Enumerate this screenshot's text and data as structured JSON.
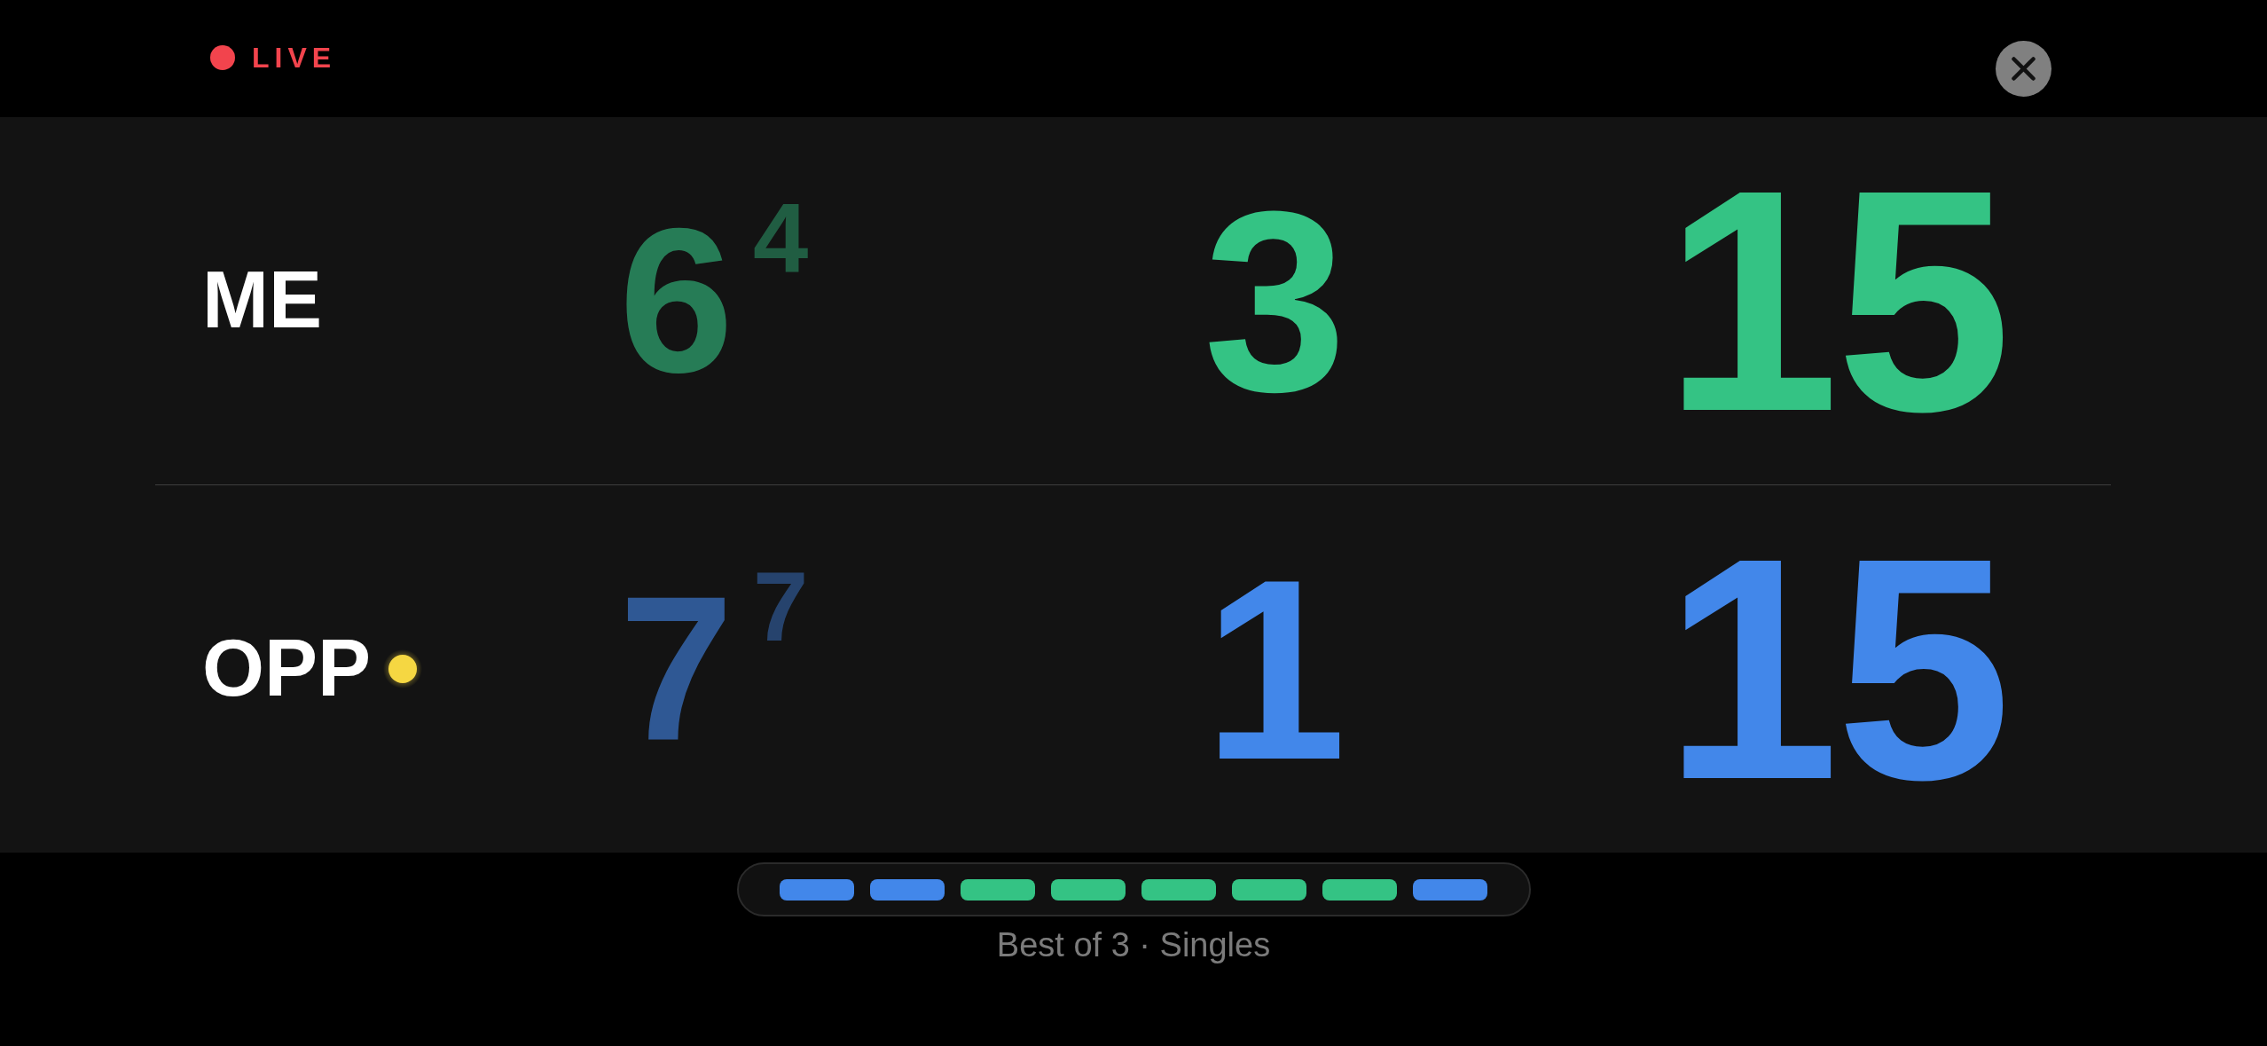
{
  "status": {
    "label": "LIVE"
  },
  "players": [
    {
      "name": "ME",
      "serving": false,
      "color": "#34c384",
      "sets": [
        {
          "games": "6",
          "tiebreak": "4"
        }
      ],
      "games": "3",
      "points": "15"
    },
    {
      "name": "OPP",
      "serving": true,
      "color": "#4287ea",
      "sets": [
        {
          "games": "7",
          "tiebreak": "7"
        }
      ],
      "games": "1",
      "points": "15"
    }
  ],
  "game_history": [
    {
      "color": "#4287ea"
    },
    {
      "color": "#4287ea"
    },
    {
      "color": "#34c384"
    },
    {
      "color": "#34c384"
    },
    {
      "color": "#34c384"
    },
    {
      "color": "#34c384"
    },
    {
      "color": "#34c384"
    },
    {
      "color": "#4287ea"
    }
  ],
  "caption": "Best of 3 · Singles"
}
